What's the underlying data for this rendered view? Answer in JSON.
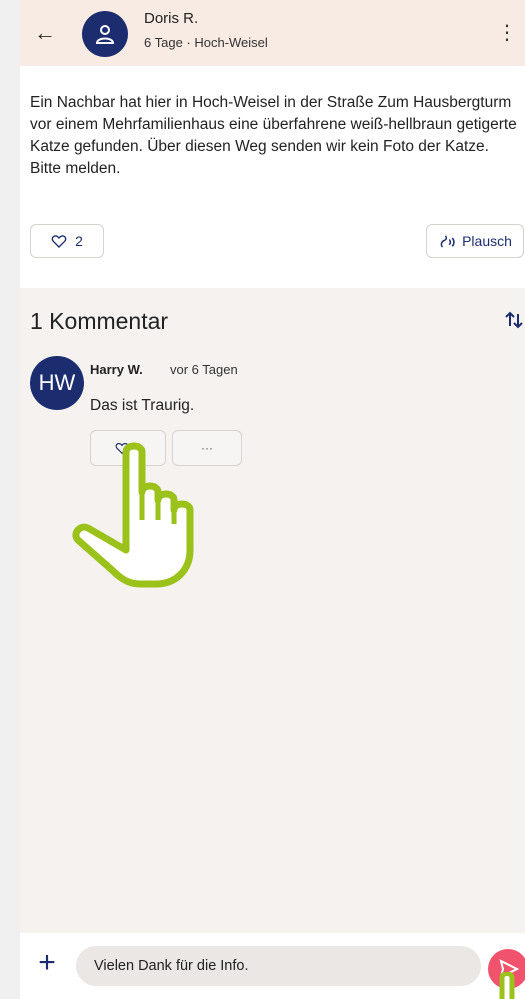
{
  "header": {
    "author_name": "Doris R.",
    "meta": "6 Tage · Hoch-Weisel"
  },
  "post": {
    "text": "Ein Nachbar hat hier in Hoch-Weisel in der Straße Zum Hausbergturm vor einem Mehrfamilienhaus eine überfahrene weiß-hellbraun getigerte Katze gefunden. Über diesen Weg senden wir kein Foto der Katze. Bitte melden.",
    "like_count": "2",
    "plausch_label": "Plausch"
  },
  "comments": {
    "title": "1 Kommentar",
    "items": [
      {
        "avatar_initials": "HW",
        "author": "Harry W.",
        "time": "vor 6 Tagen",
        "text": "Das ist Traurig.",
        "like_count": "0",
        "more_label": "···"
      }
    ]
  },
  "composer": {
    "input_value": "Vielen Dank für die Info."
  },
  "colors": {
    "brand_navy": "#1b2d6e",
    "send_pink": "#f1536c",
    "hand_green": "#9bc21a"
  }
}
